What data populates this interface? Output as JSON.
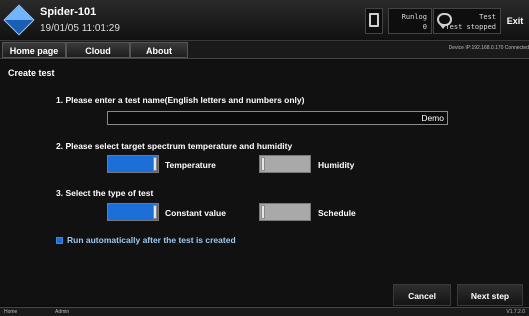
{
  "titlebar": {
    "app_name": "Spider-101",
    "datetime": "19/01/05 11:01:29",
    "analog_label": "Runlog",
    "analog_value": "0",
    "status_line1": "Test",
    "status_line2": "Test stopped",
    "exit_label": "Exit"
  },
  "nav": {
    "tabs": [
      "Home page",
      "Cloud",
      "About"
    ],
    "device_info": "Device IP:192.168.0.170 Connected"
  },
  "form": {
    "page_title": "Create test",
    "step1_label": "1. Please enter a test name(English letters and numbers only)",
    "test_name_value": "Demo",
    "step2_label": "2. Please select target spectrum temperature and humidity",
    "temperature_label": "Temperature",
    "humidity_label": "Humidity",
    "temperature_on": true,
    "humidity_on": false,
    "step3_label": "3. Select the type of test",
    "constant_label": "Constant value",
    "schedule_label": "Schedule",
    "constant_on": true,
    "schedule_on": false,
    "auto_run_label": "Run automatically after the test is created"
  },
  "actions": {
    "cancel_label": "Cancel",
    "next_label": "Next step"
  },
  "statusbar": {
    "left": "Home",
    "user": "Admin",
    "version": "V1.7.2.0"
  },
  "colors": {
    "toggle_on": "#1c6fd9",
    "toggle_off": "#a9a9a9",
    "background": "#111111"
  }
}
